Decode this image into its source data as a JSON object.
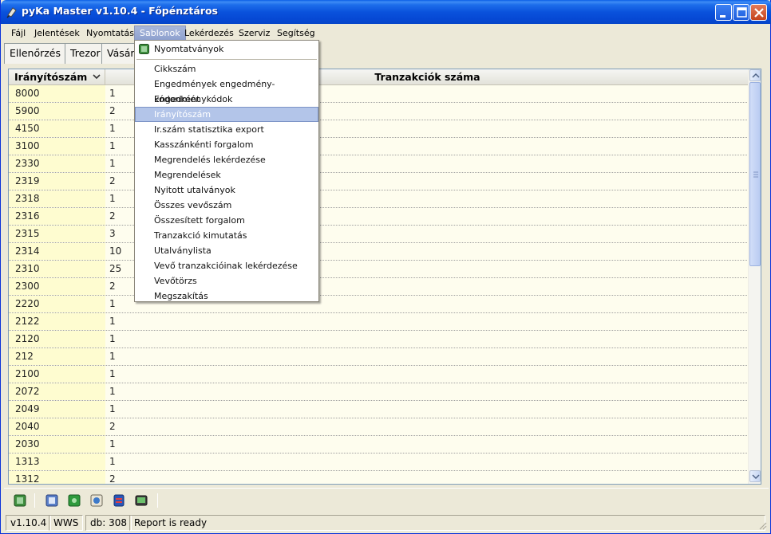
{
  "window": {
    "title": "pyKa Master v1.10.4 - Főpénztáros"
  },
  "menubar": {
    "items": [
      {
        "label": "Fájl"
      },
      {
        "label": "Jelentések"
      },
      {
        "label": "Nyomtatás"
      },
      {
        "label": "Sablonok"
      },
      {
        "label": "Lekérdezés"
      },
      {
        "label": "Szerviz"
      },
      {
        "label": "Segítség"
      }
    ],
    "active": "Sablonok"
  },
  "tabs": [
    {
      "label": "Ellenőrzés"
    },
    {
      "label": "Trezor"
    },
    {
      "label": "Vásár"
    }
  ],
  "grid": {
    "columns": [
      "Irányítószám",
      "Tranzakciók száma"
    ],
    "rows": [
      [
        "8000",
        "1"
      ],
      [
        "5900",
        "2"
      ],
      [
        "4150",
        "1"
      ],
      [
        "3100",
        "1"
      ],
      [
        "2330",
        "1"
      ],
      [
        "2319",
        "2"
      ],
      [
        "2318",
        "1"
      ],
      [
        "2316",
        "2"
      ],
      [
        "2315",
        "3"
      ],
      [
        "2314",
        "10"
      ],
      [
        "2310",
        "25"
      ],
      [
        "2300",
        "2"
      ],
      [
        "2220",
        "1"
      ],
      [
        "2122",
        "1"
      ],
      [
        "2120",
        "1"
      ],
      [
        "212",
        "1"
      ],
      [
        "2100",
        "1"
      ],
      [
        "2072",
        "1"
      ],
      [
        "2049",
        "1"
      ],
      [
        "2040",
        "2"
      ],
      [
        "2030",
        "1"
      ],
      [
        "1313",
        "1"
      ],
      [
        "1312",
        "2"
      ]
    ]
  },
  "dropdown": {
    "top_item": {
      "label": "Nyomtatványok",
      "icon": "form-icon"
    },
    "items": [
      {
        "label": "Cikkszám"
      },
      {
        "label": "Engedmények engedmény-kódonként"
      },
      {
        "label": "Engedménykódok"
      },
      {
        "label": "Irányítószám"
      },
      {
        "label": "Ir.szám statisztika export"
      },
      {
        "label": "Kasszánkénti forgalom"
      },
      {
        "label": "Megrendelés lekérdezése"
      },
      {
        "label": "Megrendelések"
      },
      {
        "label": "Nyitott utalványok"
      },
      {
        "label": "Összes vevőszám"
      },
      {
        "label": "Összesített forgalom"
      },
      {
        "label": "Tranzakció kimutatás"
      },
      {
        "label": "Utalványlista"
      },
      {
        "label": "Vevő tranzakcióinak lekérdezése"
      },
      {
        "label": "Vevőtörzs"
      },
      {
        "label": "Megszakítás"
      }
    ],
    "highlighted": "Irányítószám"
  },
  "toolbar": {
    "icons": [
      "exit-icon",
      "calculator-icon",
      "settings-icon",
      "refresh-icon",
      "database-icon",
      "screen-icon"
    ]
  },
  "statusbar": {
    "version": "v1.10.4",
    "user": "WWS",
    "db": "db: 308",
    "message": "Report is ready"
  },
  "colors": {
    "titlebar": "#0A52DC",
    "menu_highlight": "#B3C5E9",
    "row_key_bg": "#FEFCD0",
    "row_bg": "#FEFDEE"
  }
}
